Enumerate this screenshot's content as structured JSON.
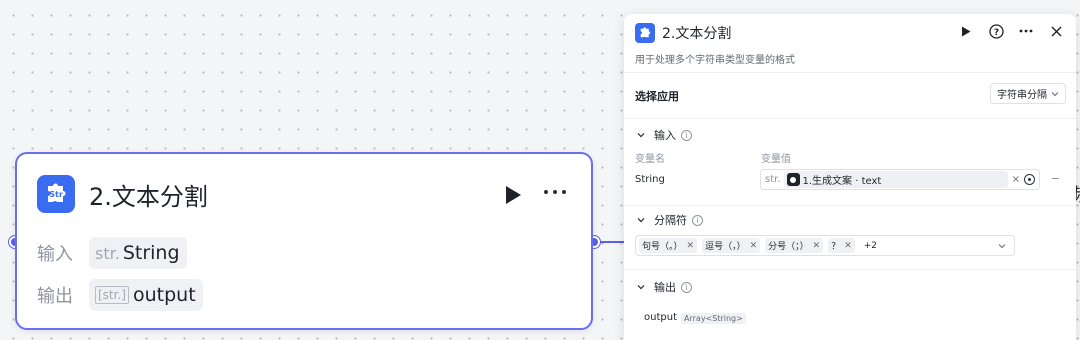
{
  "node": {
    "title": "2.文本分割",
    "input_label": "输入",
    "input_type": "str.",
    "input_value": "String",
    "output_label": "输出",
    "output_type": "[str.]",
    "output_value": "output"
  },
  "panel": {
    "title": "2.文本分割",
    "description": "用于处理多个字符串类型变量的格式",
    "select_app": {
      "label": "选择应用",
      "value": "字符串分隔"
    },
    "input": {
      "header": "输入",
      "col_name": "变量名",
      "col_value": "变量值",
      "var_name": "String",
      "ref_prefix": "str.",
      "ref_value": "1.生成文案 · text"
    },
    "separator": {
      "header": "分隔符",
      "tags": [
        {
          "label": "句号（。）"
        },
        {
          "label": "逗号（，）"
        },
        {
          "label": "分号（；）"
        },
        {
          "label": "？"
        }
      ],
      "more": "+2"
    },
    "output": {
      "header": "输出",
      "var_name": "output",
      "var_type": "Array<String>"
    }
  },
  "edge_char": "频",
  "colors": {
    "accent": "#5a5fe6",
    "icon_bg": "#3a6cf1"
  }
}
